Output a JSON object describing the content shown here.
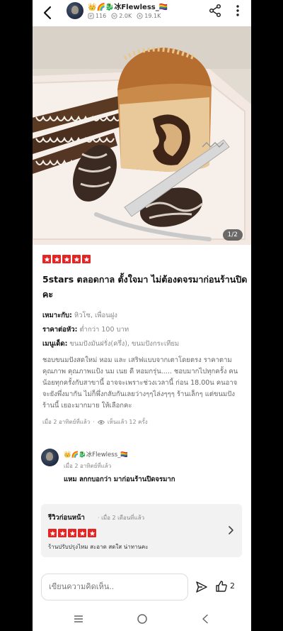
{
  "header": {
    "username": "👑🌈🐉冰Flewless_🏳️‍🌈",
    "stats": {
      "reviews": "116",
      "followers": "2.0K",
      "likes": "19.1K"
    }
  },
  "photo": {
    "page_indicator": "1/2"
  },
  "post": {
    "rating": 5,
    "title": "5stars ตลอดกาล ตั้งใจมา ไม่ต้องดจรมาก่อนร้านปิดคะ",
    "suitable_label": "เหมาะกับ:",
    "suitable_value": "หิวโซ, เพื่อนฝูง",
    "price_label": "ราคาต่อหัว:",
    "price_value": "ต่ำกว่า 100 บาท",
    "menu_label": "เมนูเด็ด:",
    "menu_value": "ขนมปังมันฝรั่ง(ครึ่ง), ขนมปังกระเทียม",
    "body": "ชอบขนมปังสดใหม่ หอม และ เสริฟแบบจากเตาโดยตรง ราคาตามคุณภาพ คุณภาพแป้ง นม เนย ดี หอมกรุ่น..... ชอบมากไปทุกครั้ง คนน้อยทุกครั้งกับสาขานี้ อาจจะเพราะช่วงเวลานี้ ก่อน 18.00น คนอาจจะยังพึ่งมากัน ไม่ก็พึ่งกลับกันเลยว่างๆๆไล่งๆๆๆ ร้านเล็กๆ แต่ขนมปังร้านนี้ เยอะมากมาย ให้เลือกคะ",
    "time": "เมื่อ 2 อาทิตย์ที่แล้ว",
    "separator": "·",
    "views": "เห็นแล้ว 12 ครั้ง"
  },
  "comment": {
    "username": "👑🌈🐉冰Flewless_🏳️‍🌈",
    "time": "เมื่อ 2 อาทิตย์ที่แล้ว",
    "text": "แหม ลกกบอกว่า มาก่อนร้านปิดจรมาก"
  },
  "previous_review": {
    "title": "รีวิวก่อนหน้า",
    "separator": "·",
    "time": "เมื่อ 2 เดือนที่แล้ว",
    "rating": 5,
    "text": "ร้านปรับปรุงไหม สะอาด สดใส น่าทานคะ"
  },
  "bottom_bar": {
    "comment_placeholder": "เขียนความคิดเห็น..",
    "like_count": "2"
  },
  "colors": {
    "star_red": "#e22626"
  }
}
